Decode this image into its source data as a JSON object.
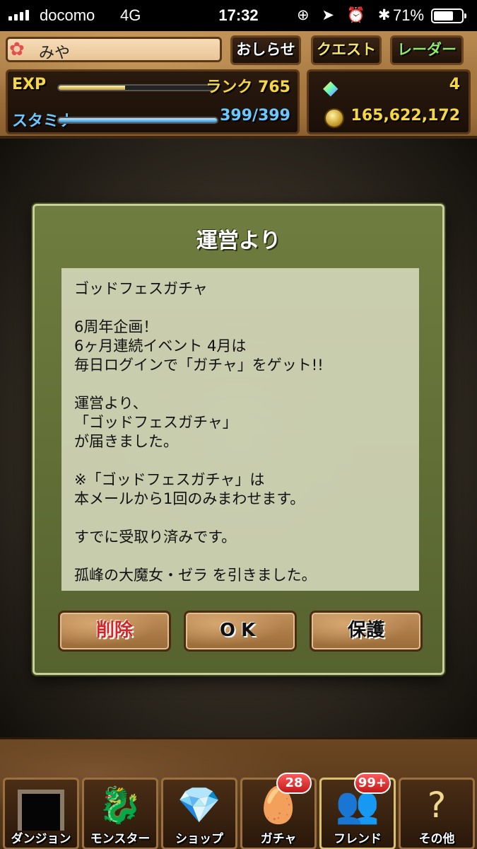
{
  "status_bar": {
    "carrier": "docomo",
    "network": "4G",
    "time": "17:32",
    "icons": "⊕ ➤ ⏰ ✱",
    "battery_pct": "71%",
    "battery_level": 0.71
  },
  "header": {
    "player_name": "みや",
    "buttons": {
      "notice": "おしらせ",
      "quest": "クエスト",
      "radar": "レーダー"
    },
    "exp_label": "EXP",
    "exp_progress": 0.42,
    "rank": "ランク 765",
    "stamina_label": "スタミナ",
    "stamina_progress": 1.0,
    "stamina_value": "399/399",
    "magic_stones": "4",
    "coins": "165,622,172"
  },
  "dialog": {
    "title": "運営より",
    "message": "ゴッドフェスガチャ\n\n6周年企画！\n6ヶ月連続イベント 4月は\n毎日ログインで「ガチャ」をゲット!!\n\n運営より、\n「ゴッドフェスガチャ」\nが届きました。\n\n※「ゴッドフェスガチャ」は\n本メールから1回のみまわせます。\n\nすでに受取り済みです。\n\n孤峰の大魔女・ゼラ を引きました。",
    "buttons": {
      "delete": "削除",
      "ok": "OK",
      "protect": "保護"
    }
  },
  "nav": {
    "dungeon": {
      "label": "ダンジョン"
    },
    "monster": {
      "label": "モンスター"
    },
    "shop": {
      "label": "ショップ"
    },
    "gacha": {
      "label": "ガチャ",
      "badge": "28"
    },
    "friend": {
      "label": "フレンド",
      "badge": "99+"
    },
    "other": {
      "label": "その他"
    }
  },
  "colors": {
    "dialog_bg": "#6f7d40",
    "delete_text": "#d02828",
    "exp_text": "#f5d646",
    "stamina_text": "#6cc7ff"
  }
}
